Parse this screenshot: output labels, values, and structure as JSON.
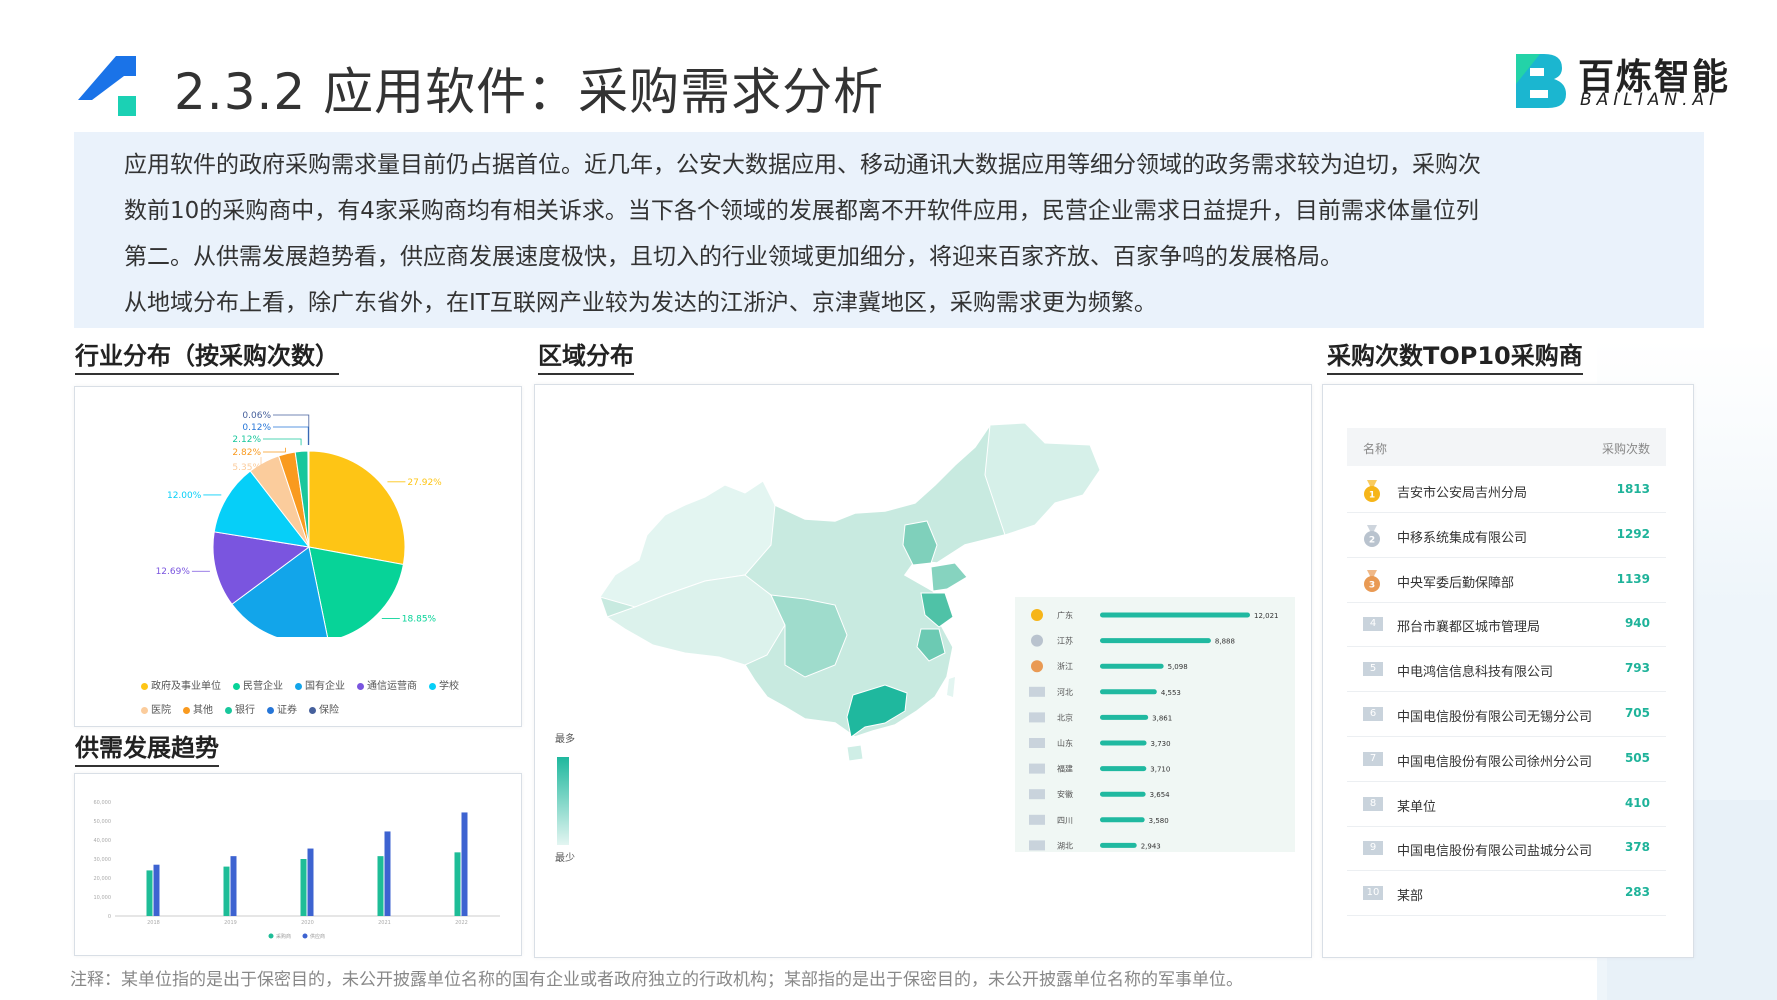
{
  "header": {
    "title": "2.3.2 应用软件：采购需求分析",
    "brand_name": "百炼智能",
    "brand_sub": "BAILIAN.AI"
  },
  "intro": {
    "lines": [
      "应用软件的政府采购需求量目前仍占据首位。近几年，公安大数据应用、移动通讯大数据应用等细分领域的政务需求较为迫切，采购次",
      "数前10的采购商中，有4家采购商均有相关诉求。当下各个领域的发展都离不开软件应用，民营企业需求日益提升，目前需求体量位列",
      "第二。从供需发展趋势看，供应商发展速度极快，且切入的行业领域更加细分，将迎来百家齐放、百家争鸣的发展格局。",
      "从地域分布上看，除广东省外，在IT互联网产业较为发达的江浙沪、京津冀地区，采购需求更为频繁。"
    ]
  },
  "sections": {
    "industry": "行业分布（按采购次数）",
    "region": "区域分布",
    "top10": "采购次数TOP10采购商",
    "trend": "供需发展趋势"
  },
  "chart_data": [
    {
      "type": "pie",
      "slices": [
        {
          "name": "政府及事业单位",
          "value": 27.92,
          "label": "27.92%",
          "color": "#fec515"
        },
        {
          "name": "民营企业",
          "value": 18.85,
          "label": "18.85%",
          "color": "#07d398"
        },
        {
          "name": "国有企业",
          "value": 18.06,
          "label": "18.06%",
          "color": "#12a5ea"
        },
        {
          "name": "通信运营商",
          "value": 12.69,
          "label": "12.69%",
          "color": "#7a55df"
        },
        {
          "name": "学校",
          "value": 12.0,
          "label": "12.00%",
          "color": "#06cff8"
        },
        {
          "name": "医院",
          "value": 5.35,
          "label": "5.35%",
          "color": "#fbcc9c"
        },
        {
          "name": "其他",
          "value": 2.82,
          "label": "2.82%",
          "color": "#f99a1f"
        },
        {
          "name": "银行",
          "value": 2.12,
          "label": "2.12%",
          "color": "#18c79c"
        },
        {
          "name": "证券",
          "value": 0.12,
          "label": "0.12%",
          "color": "#2676d8"
        },
        {
          "name": "保险",
          "value": 0.06,
          "label": "0.06%",
          "color": "#46609c"
        }
      ]
    },
    {
      "type": "bar",
      "title": "",
      "categories": [
        "2018",
        "2019",
        "2020",
        "2021",
        "2022"
      ],
      "series": [
        {
          "name": "采购商",
          "color": "#1ebd97",
          "values": [
            24000,
            26000,
            30000,
            31500,
            33500
          ]
        },
        {
          "name": "供应商",
          "color": "#3d63d1",
          "values": [
            27000,
            31500,
            35500,
            44500,
            54500
          ]
        }
      ],
      "ylim": [
        0,
        60000
      ],
      "yticks": [
        "0",
        "10,000",
        "20,000",
        "30,000",
        "40,000",
        "50,000",
        "60,000"
      ],
      "grid": false
    },
    {
      "type": "bar",
      "orientation": "horizontal",
      "categories": [
        "广东",
        "江苏",
        "浙江",
        "河北",
        "北京",
        "山东",
        "福建",
        "安徽",
        "四川",
        "湖北"
      ],
      "values": [
        12021,
        8888,
        5098,
        4553,
        3861,
        3730,
        3710,
        3654,
        3580,
        2943
      ],
      "value_labels": [
        "12,021",
        "8,888",
        "5,098",
        "4,553",
        "3,861",
        "3,730",
        "3,710",
        "3,654",
        "3,580",
        "2,943"
      ],
      "color": "#20b9a0"
    }
  ],
  "map": {
    "legend_max": "最多",
    "legend_min": "最少",
    "color_high": "#1fb89e",
    "color_low": "#e3f5f1"
  },
  "top10": {
    "col_name": "名称",
    "col_count": "采购次数",
    "rows": [
      {
        "rank": "1",
        "name": "吉安市公安局吉州分局",
        "count": "1813"
      },
      {
        "rank": "2",
        "name": "中移系统集成有限公司",
        "count": "1292"
      },
      {
        "rank": "3",
        "name": "中央军委后勤保障部",
        "count": "1139"
      },
      {
        "rank": "4",
        "name": "邢台市襄都区城市管理局",
        "count": "940"
      },
      {
        "rank": "5",
        "name": "中电鸿信信息科技有限公司",
        "count": "793"
      },
      {
        "rank": "6",
        "name": "中国电信股份有限公司无锡分公司",
        "count": "705"
      },
      {
        "rank": "7",
        "name": "中国电信股份有限公司徐州分公司",
        "count": "505"
      },
      {
        "rank": "8",
        "name": "某单位",
        "count": "410"
      },
      {
        "rank": "9",
        "name": "中国电信股份有限公司盐城分公司",
        "count": "378"
      },
      {
        "rank": "10",
        "name": "某部",
        "count": "283"
      }
    ]
  },
  "note": "注释：某单位指的是出于保密目的，未公开披露单位名称的国有企业或者政府独立的行政机构；某部指的是出于保密目的，未公开披露单位名称的军事单位。"
}
